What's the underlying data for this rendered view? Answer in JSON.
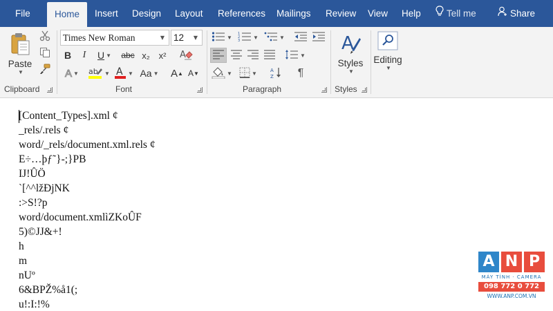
{
  "tabs": [
    {
      "label": "File",
      "active": false
    },
    {
      "label": "Home",
      "active": true
    },
    {
      "label": "Insert",
      "active": false
    },
    {
      "label": "Design",
      "active": false
    },
    {
      "label": "Layout",
      "active": false
    },
    {
      "label": "References",
      "active": false
    },
    {
      "label": "Mailings",
      "active": false
    },
    {
      "label": "Review",
      "active": false
    },
    {
      "label": "View",
      "active": false
    },
    {
      "label": "Help",
      "active": false
    }
  ],
  "tell_me": "Tell me",
  "share": "Share",
  "clipboard": {
    "paste_label": "Paste",
    "group_label": "Clipboard"
  },
  "font": {
    "font_name": "Times New Roman",
    "font_size": "12",
    "bold": "B",
    "italic": "I",
    "underline": "U",
    "strike": "abc",
    "subscript": "x₂",
    "superscript": "x²",
    "clear_format": "A",
    "text_effects": "A",
    "highlight": "ab",
    "font_color": "A",
    "change_case": "Aa",
    "grow": "A",
    "shrink": "A",
    "group_label": "Font"
  },
  "paragraph": {
    "show_marks": "¶",
    "group_label": "Paragraph"
  },
  "styles": {
    "label": "Styles",
    "group_label": "Styles"
  },
  "editing": {
    "label": "Editing"
  },
  "colors": {
    "accent": "#2b579a",
    "ribbon_bg": "#f3f3f3",
    "highlight_yellow": "#ffff00",
    "font_red": "#e02020"
  },
  "document": {
    "lines": [
      "[Content_Types].xml ¢",
      "_rels/.rels ¢",
      "word/_rels/document.xml.rels ¢",
      "E÷…þƒ˜}-;}PB",
      "IJ!ÛÖ",
      "`[^^lžĐjNK",
      ":>S!?p",
      "word/document.xmlìZKoÛF",
      "5)©JJ&+!",
      "h",
      "m",
      "nUº",
      "6&BPŽ%å1(;",
      "u!:I:!%"
    ]
  },
  "watermark": {
    "letters": [
      "A",
      "N",
      "P"
    ],
    "subtitle": "MÁY TÍNH · CAMERA",
    "phone": "098 772 0 772",
    "url": "WWW.ANP.COM.VN"
  }
}
